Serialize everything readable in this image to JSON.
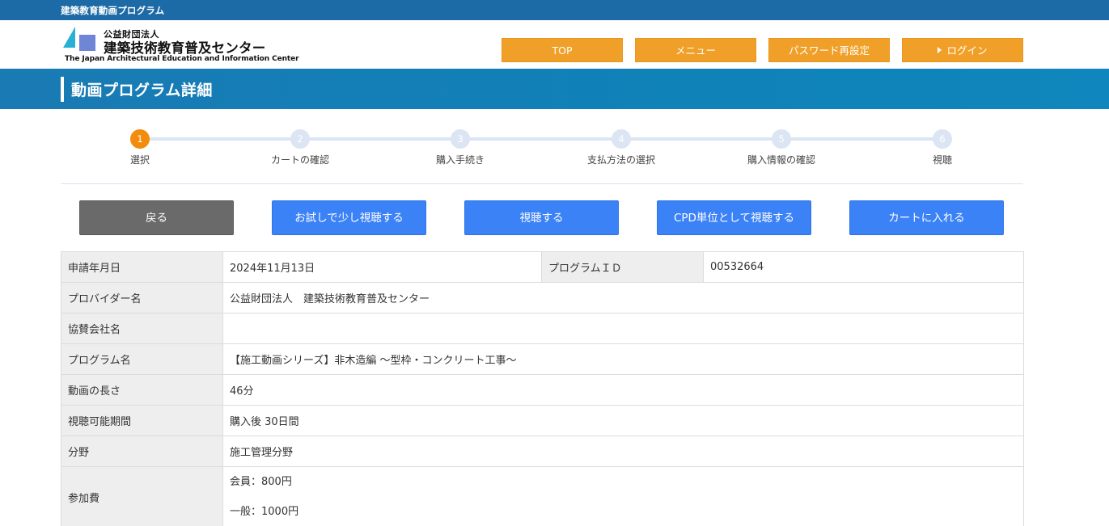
{
  "site_strip": {
    "label": "建築教育動画プログラム"
  },
  "logo": {
    "small": "公益財団法人",
    "big": "建築技術教育普及センター",
    "english": "The Japan Architectural Education and Information Center"
  },
  "nav": {
    "top": "TOP",
    "menu": "メニュー",
    "password": "パスワード再設定",
    "login": "ログイン"
  },
  "page_title": "動画プログラム詳細",
  "stepper": {
    "steps": [
      {
        "num": "1",
        "label": "選択",
        "active": true
      },
      {
        "num": "2",
        "label": "カートの確認",
        "active": false
      },
      {
        "num": "3",
        "label": "購入手続き",
        "active": false
      },
      {
        "num": "4",
        "label": "支払方法の選択",
        "active": false
      },
      {
        "num": "5",
        "label": "購入情報の確認",
        "active": false
      },
      {
        "num": "6",
        "label": "視聴",
        "active": false
      }
    ]
  },
  "actions": {
    "back": "戻る",
    "trial": "お試しで少し視聴する",
    "watch": "視聴する",
    "cpd": "CPD単位として視聴する",
    "cart": "カートに入れる"
  },
  "details": {
    "apply_date_label": "申請年月日",
    "apply_date_value": "2024年11月13日",
    "program_id_label": "プログラムＩＤ",
    "program_id_value": "00532664",
    "provider_label": "プロバイダー名",
    "provider_value": "公益財団法人　建築技術教育普及センター",
    "sponsor_label": "協賛会社名",
    "sponsor_value": "",
    "program_name_label": "プログラム名",
    "program_name_value": "【施工動画シリーズ】非木造編 ～型枠・コンクリート工事～",
    "length_label": "動画の長さ",
    "length_value": "46分",
    "period_label": "視聴可能期間",
    "period_value": "購入後 30日間",
    "field_label": "分野",
    "field_value": "施工管理分野",
    "fee_label": "参加費",
    "fee_member": "会員：800円",
    "fee_general": "一般：1000円"
  },
  "colors": {
    "strip": "#1c6aa6",
    "nav_button": "#f0a028",
    "title_band": "#0f82b8",
    "step_active": "#f28c0c",
    "step_inactive": "#dbe5f3",
    "action_blue": "#3b82f6",
    "action_gray": "#6a6a6a"
  }
}
